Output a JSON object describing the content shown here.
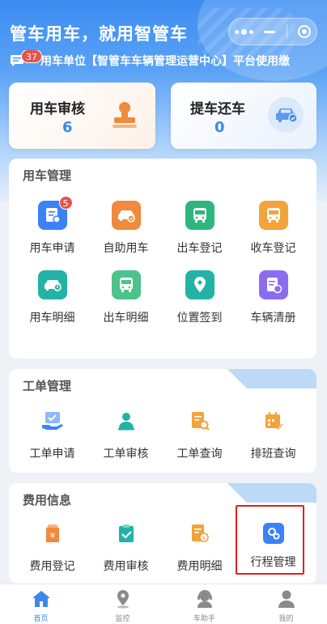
{
  "header": {
    "title": "管车用车，就用智管车",
    "notice_badge": "37",
    "notice_text": "用车单位【智管车车辆管理运营中心】平台使用缴"
  },
  "stats": [
    {
      "label": "用车审核",
      "value": "6"
    },
    {
      "label": "提车还车",
      "value": "0"
    }
  ],
  "sections": [
    {
      "title": "用车管理",
      "items": [
        {
          "label": "用车申请",
          "icon": "car-apply-icon",
          "color": "#3b82f6",
          "badge": "5"
        },
        {
          "label": "自助用车",
          "icon": "self-drive-icon",
          "color": "#f08a3c"
        },
        {
          "label": "出车登记",
          "icon": "bus-out-icon",
          "color": "#2fb67c"
        },
        {
          "label": "收车登记",
          "icon": "bus-in-icon",
          "color": "#f2a33a"
        },
        {
          "label": "用车明细",
          "icon": "car-detail-icon",
          "color": "#22b3a6"
        },
        {
          "label": "出车明细",
          "icon": "bus-detail-icon",
          "color": "#4cc38a"
        },
        {
          "label": "位置签到",
          "icon": "location-icon",
          "color": "#22b3a6"
        },
        {
          "label": "车辆清册",
          "icon": "vehicle-list-icon",
          "color": "#8b6cf0"
        }
      ]
    },
    {
      "title": "工单管理",
      "items": [
        {
          "label": "工单申请",
          "icon": "order-apply-icon",
          "color": "#3b82f6"
        },
        {
          "label": "工单审核",
          "icon": "order-review-icon",
          "color": "#22b3a6"
        },
        {
          "label": "工单查询",
          "icon": "order-query-icon",
          "color": "#f2a33a"
        },
        {
          "label": "排班查询",
          "icon": "schedule-icon",
          "color": "#f2a33a"
        }
      ]
    },
    {
      "title": "费用信息",
      "items": [
        {
          "label": "费用登记",
          "icon": "fee-register-icon",
          "color": "#f08a3c"
        },
        {
          "label": "费用审核",
          "icon": "fee-review-icon",
          "color": "#22b3a6"
        },
        {
          "label": "费用明细",
          "icon": "fee-detail-icon",
          "color": "#f2a33a"
        },
        {
          "label": "行程管理",
          "icon": "trip-manage-icon",
          "color": "#3b82f6"
        }
      ]
    }
  ],
  "tabbar": [
    {
      "label": "首页",
      "active": true
    },
    {
      "label": "监控"
    },
    {
      "label": "车助手"
    },
    {
      "label": "我的"
    }
  ],
  "colors": {
    "primary": "#3a89e8",
    "badge": "#e5534b",
    "highlight": "#e02020"
  }
}
